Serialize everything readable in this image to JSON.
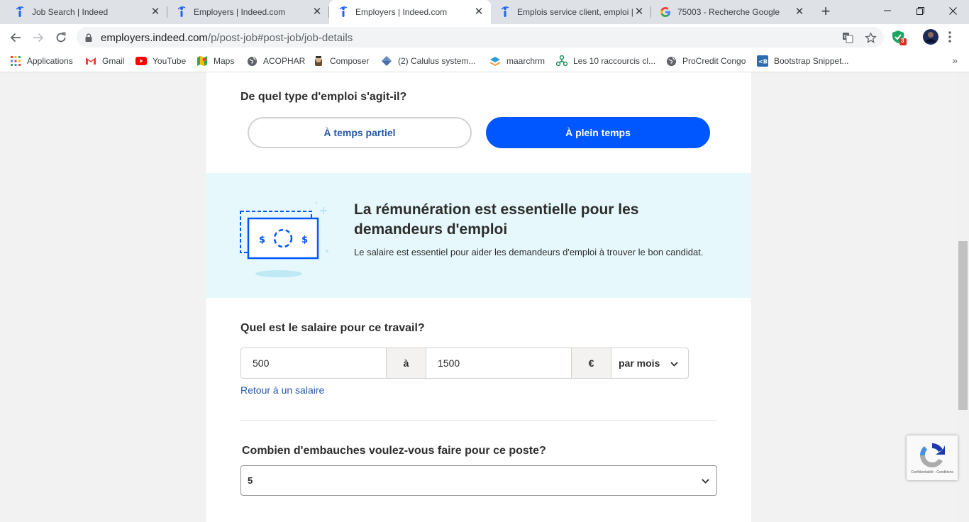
{
  "browser": {
    "tabs": [
      {
        "title": "Job Search | Indeed",
        "icon": "indeed-icon"
      },
      {
        "title": "Employers | Indeed.com",
        "icon": "indeed-icon"
      },
      {
        "title": "Employers | Indeed.com",
        "icon": "indeed-icon",
        "active": true
      },
      {
        "title": "Emplois service client, emploi |",
        "icon": "indeed-icon"
      },
      {
        "title": "75003 - Recherche Google",
        "icon": "google-icon"
      }
    ],
    "new_tab_label": "+",
    "url_host": "employers.indeed.com",
    "url_path": "/p/post-job#post-job/job-details",
    "extension_badge": "3",
    "bookmarks": [
      {
        "label": "Applications",
        "icon": "apps-grid-icon"
      },
      {
        "label": "Gmail",
        "icon": "gmail-icon"
      },
      {
        "label": "YouTube",
        "icon": "youtube-icon"
      },
      {
        "label": "Maps",
        "icon": "maps-icon"
      },
      {
        "label": "ACOPHAR",
        "icon": "globe-icon"
      },
      {
        "label": "Composer",
        "icon": "composer-icon"
      },
      {
        "label": "(2) Calulus system...",
        "icon": "calculus-icon"
      },
      {
        "label": "maarchrm",
        "icon": "maarch-icon"
      },
      {
        "label": "Les 10 raccourcis cl...",
        "icon": "tree-icon"
      },
      {
        "label": "ProCredit Congo",
        "icon": "globe-icon"
      },
      {
        "label": "Bootstrap Snippet...",
        "icon": "bootstrap-icon"
      }
    ]
  },
  "page": {
    "job_type": {
      "question": "De quel type d'emploi s'agit-il?",
      "part_time_label": "À temps partiel",
      "full_time_label": "À plein temps",
      "selected": "full_time"
    },
    "banner": {
      "title": "La rémunération est essentielle pour les demandeurs d'emploi",
      "text": "Le salaire est essentiel pour aider les demandeurs d'emploi à trouver le bon candidat."
    },
    "salary": {
      "question": "Quel est le salaire pour ce travail?",
      "min": "500",
      "separator": "à",
      "max": "1500",
      "currency": "€",
      "period": "par mois",
      "back_link": "Retour à un salaire"
    },
    "hires": {
      "question": "Combien d'embauches voulez-vous faire pour ce poste?",
      "value": "5"
    }
  },
  "recaptcha": {
    "text": "Confidentialité - Conditions"
  },
  "colors": {
    "primary_blue": "#0057ff",
    "link_blue": "#2557a7",
    "banner_bg": "#e6f8fb"
  }
}
